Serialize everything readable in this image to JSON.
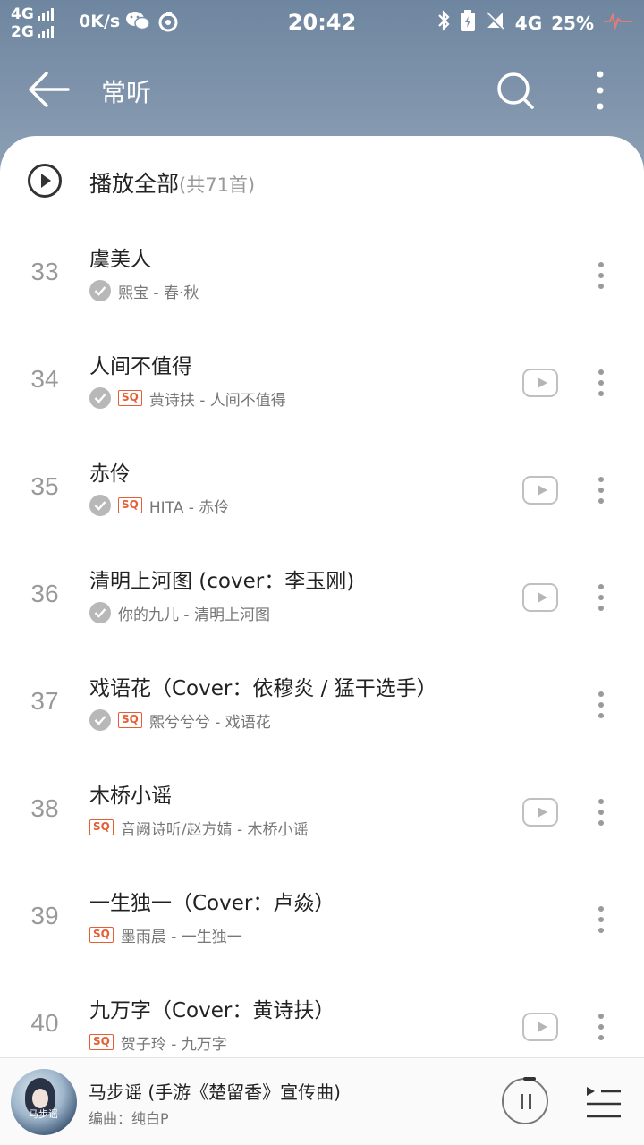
{
  "status_bar": {
    "network_top": "4G",
    "network_bottom": "2G",
    "speed": "0K/s",
    "time": "20:42",
    "network_right": "4G",
    "battery": "25%"
  },
  "header": {
    "title": "常听"
  },
  "play_all": {
    "label": "播放全部",
    "count": "(共71首)"
  },
  "songs": [
    {
      "index": "33",
      "title": "虞美人",
      "meta": "熙宝 - 春·秋",
      "downloaded": true,
      "sq": false,
      "mv": false
    },
    {
      "index": "34",
      "title": "人间不值得",
      "meta": "黄诗扶 - 人间不值得",
      "downloaded": true,
      "sq": true,
      "mv": true
    },
    {
      "index": "35",
      "title": "赤伶",
      "meta": "HITA - 赤伶",
      "downloaded": true,
      "sq": true,
      "mv": true
    },
    {
      "index": "36",
      "title": "清明上河图 (cover：李玉刚)",
      "meta": "你的九儿 - 清明上河图",
      "downloaded": true,
      "sq": false,
      "mv": true
    },
    {
      "index": "37",
      "title": "戏语花（Cover：依穆炎 / 猛干选手）",
      "meta": "熙兮兮兮 - 戏语花",
      "downloaded": true,
      "sq": true,
      "mv": false
    },
    {
      "index": "38",
      "title": "木桥小谣",
      "meta": "音阙诗听/赵方婧 - 木桥小谣",
      "downloaded": false,
      "sq": true,
      "mv": true
    },
    {
      "index": "39",
      "title": "一生独一（Cover：卢焱）",
      "meta": "墨雨晨 - 一生独一",
      "downloaded": false,
      "sq": true,
      "mv": false
    },
    {
      "index": "40",
      "title": "九万字（Cover：黄诗扶）",
      "meta": "贺子玲 - 九万字",
      "downloaded": false,
      "sq": true,
      "mv": true
    }
  ],
  "sq_label": "SQ",
  "player": {
    "title": "马步谣 (手游《楚留香》宣传曲)",
    "subtitle": "编曲：纯白P",
    "cover_caption": "马步谣"
  },
  "colors": {
    "header_bg": "#7d92aa",
    "accent_sq": "#e55f36",
    "text_primary": "#222222",
    "text_secondary": "#777777"
  }
}
